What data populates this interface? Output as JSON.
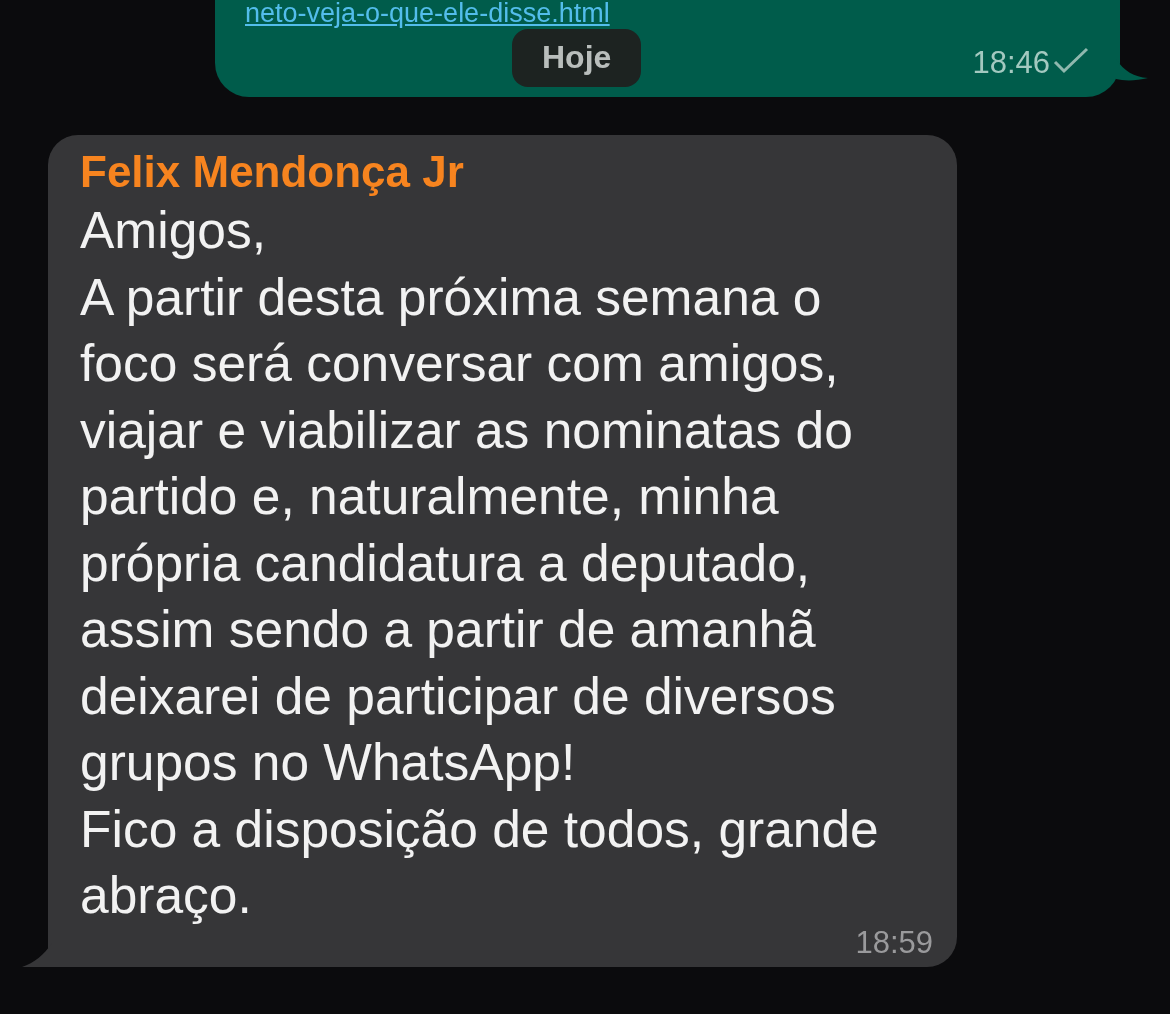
{
  "outgoing": {
    "link": "neto-veja-o-que-ele-disse.html",
    "time": "18:46",
    "read": false
  },
  "date_chip": "Hoje",
  "incoming": {
    "sender": "Felix Mendonça Jr",
    "text": "Amigos,\nA partir desta próxima semana o foco será conversar com amigos, viajar e viabilizar as nominatas do partido e, naturalmente, minha própria candidatura a deputado, assim sendo a partir de amanhã deixarei de participar de diversos grupos no WhatsApp!\nFico a disposição de todos, grande abraço.",
    "time": "18:59"
  }
}
